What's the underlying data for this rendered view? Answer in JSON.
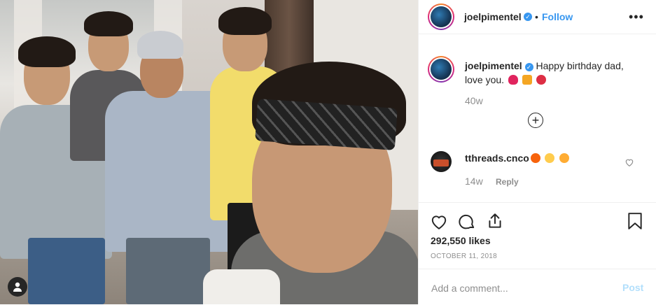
{
  "post": {
    "photo_alt": "",
    "viewer_icon": "user-silhouette-icon"
  },
  "header": {
    "username": "joelpimentel",
    "separator": "•",
    "follow_label": "Follow",
    "more_icon": "more-options-icon",
    "more_label": "•••"
  },
  "caption": {
    "username": "joelpimentel",
    "text": "Happy birthday dad, love you.",
    "time": "40w",
    "emojis": [
      "heart",
      "party-popper",
      "balloon"
    ]
  },
  "load_more": {
    "icon": "plus-circle-icon",
    "label": "+"
  },
  "comments": [
    {
      "username": "tthreads.cnco",
      "emojis": [
        "fire",
        "disappointed-face",
        "heart-eyes-face"
      ],
      "time": "14w",
      "reply_label": "Reply"
    }
  ],
  "actions": {
    "like_icon": "heart-icon",
    "comment_icon": "comment-bubble-icon",
    "share_icon": "share-icon",
    "save_icon": "bookmark-icon"
  },
  "likes": "292,550 likes",
  "date": "October 11, 2018",
  "comment_box": {
    "placeholder": "Add a comment...",
    "post_label": "Post"
  },
  "colors": {
    "accent": "#3897f0",
    "text": "#262626",
    "muted": "#8e8e8e",
    "post_disabled": "#b2dffc",
    "heart_emoji": "#e0245e"
  }
}
